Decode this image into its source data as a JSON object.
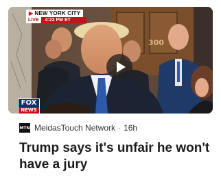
{
  "video": {
    "channel_bug": "NEW YORK CITY",
    "live_label": "LIVE",
    "live_time": "4:22 PM ET",
    "room_number": "300",
    "network_logo_top": "FOX",
    "network_logo_bottom": "NEWS",
    "play_icon": "play-icon"
  },
  "source": {
    "logo_text": "MTN",
    "name": "MeidasTouch Network",
    "separator": "·",
    "age": "16h"
  },
  "headline": "Trump says it's unfair he won't have a jury"
}
